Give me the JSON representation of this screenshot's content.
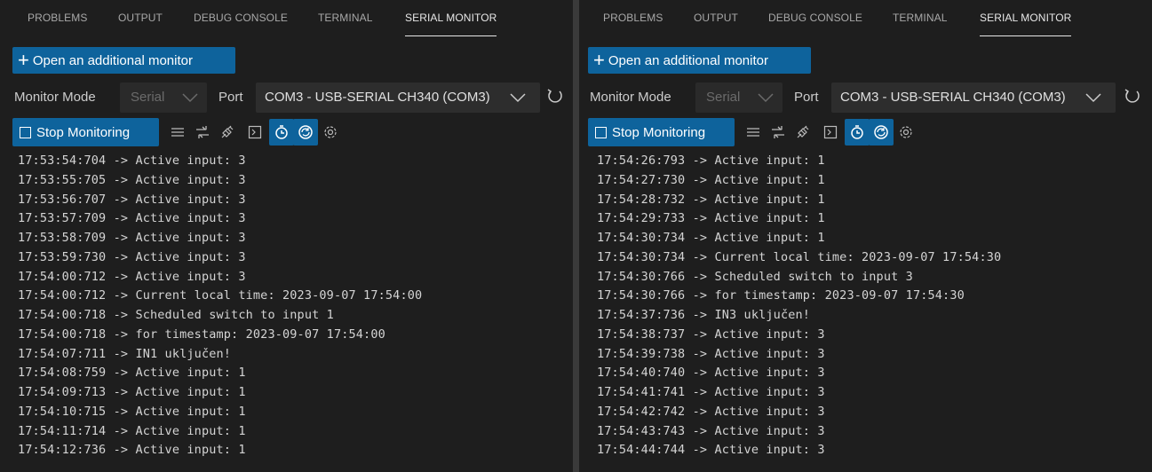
{
  "tabs": [
    "PROBLEMS",
    "OUTPUT",
    "DEBUG CONSOLE",
    "TERMINAL",
    "SERIAL MONITOR"
  ],
  "active_tab": "SERIAL MONITOR",
  "toolbar": {
    "open_monitor_label": "Open an additional monitor",
    "monitor_mode_label": "Monitor Mode",
    "monitor_mode_value": "Serial",
    "port_label": "Port",
    "port_value": "COM3 - USB-SERIAL CH340 (COM3)",
    "stop_label": "Stop Monitoring"
  },
  "colors": {
    "accent": "#0e639c",
    "background": "#1e1e1e",
    "text": "#d4d4d4"
  },
  "icons": [
    "list-icon",
    "swap-icon",
    "plug-icon",
    "terminal-icon",
    "timestamp-icon",
    "autoscroll-icon",
    "settings-icon"
  ],
  "left_monitor": {
    "lines": [
      "17:53:54:704 -> Active input: 3",
      "17:53:55:705 -> Active input: 3",
      "17:53:56:707 -> Active input: 3",
      "17:53:57:709 -> Active input: 3",
      "17:53:58:709 -> Active input: 3",
      "17:53:59:730 -> Active input: 3",
      "17:54:00:712 -> Active input: 3",
      "17:54:00:712 -> Current local time: 2023-09-07 17:54:00",
      "17:54:00:718 -> Scheduled switch to input 1",
      "17:54:00:718 -> for timestamp: 2023-09-07 17:54:00",
      "17:54:07:711 -> IN1 uključen!",
      "17:54:08:759 -> Active input: 1",
      "17:54:09:713 -> Active input: 1",
      "17:54:10:715 -> Active input: 1",
      "17:54:11:714 -> Active input: 1",
      "17:54:12:736 -> Active input: 1"
    ]
  },
  "right_monitor": {
    "lines": [
      "17:54:26:793 -> Active input: 1",
      "17:54:27:730 -> Active input: 1",
      "17:54:28:732 -> Active input: 1",
      "17:54:29:733 -> Active input: 1",
      "17:54:30:734 -> Active input: 1",
      "17:54:30:734 -> Current local time: 2023-09-07 17:54:30",
      "17:54:30:766 -> Scheduled switch to input 3",
      "17:54:30:766 -> for timestamp: 2023-09-07 17:54:30",
      "17:54:37:736 -> IN3 uključen!",
      "17:54:38:737 -> Active input: 3",
      "17:54:39:738 -> Active input: 3",
      "17:54:40:740 -> Active input: 3",
      "17:54:41:741 -> Active input: 3",
      "17:54:42:742 -> Active input: 3",
      "17:54:43:743 -> Active input: 3",
      "17:54:44:744 -> Active input: 3"
    ]
  }
}
